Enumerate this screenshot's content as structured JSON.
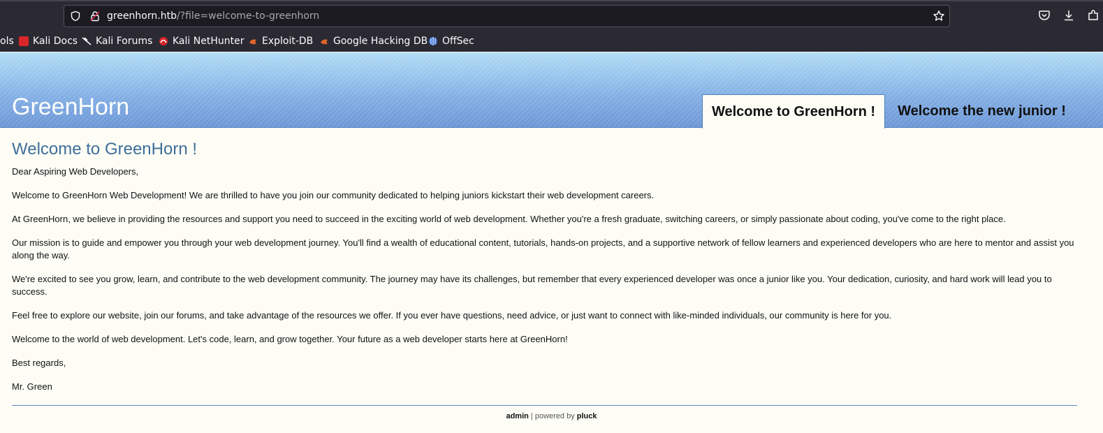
{
  "browser": {
    "url_host": "greenhorn.htb",
    "url_path": "/?file=welcome-to-greenhorn",
    "icons": [
      "shield-icon",
      "lock-icon",
      "star-icon",
      "pocket-icon",
      "download-icon",
      "extensions-icon"
    ]
  },
  "bookmarks": [
    {
      "label": "ols",
      "icon": "none"
    },
    {
      "label": "Kali Docs",
      "icon": "kali-docs-icon"
    },
    {
      "label": "Kali Forums",
      "icon": "kali-forums-icon"
    },
    {
      "label": "Kali NetHunter",
      "icon": "kali-nethunter-icon"
    },
    {
      "label": "Exploit-DB",
      "icon": "exploit-db-icon"
    },
    {
      "label": "Google Hacking DB",
      "icon": "ghdb-icon"
    },
    {
      "label": "OffSec",
      "icon": "offsec-icon"
    }
  ],
  "site": {
    "title": "GreenHorn",
    "tabs": [
      {
        "label": "Welcome to GreenHorn !",
        "active": true
      },
      {
        "label": "Welcome the new junior !",
        "active": false
      }
    ]
  },
  "content": {
    "heading": "Welcome to GreenHorn !",
    "paragraphs": [
      "Dear Aspiring Web Developers,",
      "Welcome to GreenHorn Web Development! We are thrilled to have you join our community dedicated to helping juniors kickstart their web development careers.",
      "At GreenHorn, we believe in providing the resources and support you need to succeed in the exciting world of web development. Whether you're a fresh graduate, switching careers, or simply passionate about coding, you've come to the right place.",
      "Our mission is to guide and empower you through your web development journey. You'll find a wealth of educational content, tutorials, hands-on projects, and a supportive network of fellow learners and experienced developers who are here to mentor and assist you along the way.",
      "We're excited to see you grow, learn, and contribute to the web development community. The journey may have its challenges, but remember that every experienced developer was once a junior like you. Your dedication, curiosity, and hard work will lead you to success.",
      "Feel free to explore our website, join our forums, and take advantage of the resources we offer. If you ever have questions, need advice, or just want to connect with like-minded individuals, our community is here for you.",
      "Welcome to the world of web development. Let's code, learn, and grow together. Your future as a web developer starts here at GreenHorn!",
      "Best regards,",
      "Mr. Green"
    ]
  },
  "footer": {
    "admin_link": "admin",
    "separator": " | powered by ",
    "pluck_link": "pluck"
  },
  "colors": {
    "chrome_bg": "#2b2a33",
    "heading_blue": "#3f6f9a",
    "page_bg": "#fdfdf6"
  }
}
